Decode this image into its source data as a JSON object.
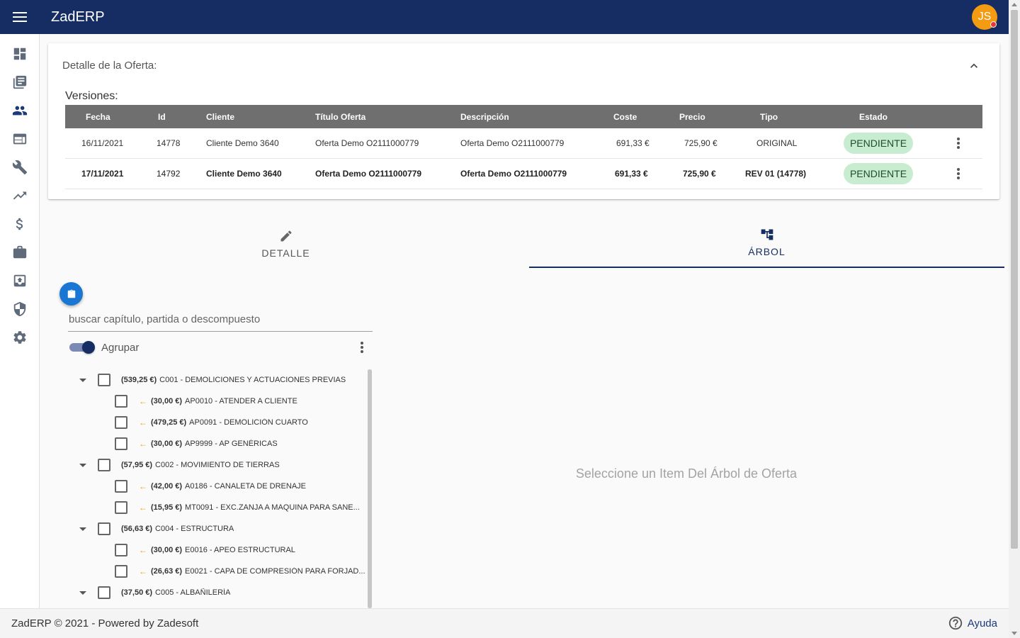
{
  "app": {
    "title": "ZadERP",
    "avatar_initials": "JS"
  },
  "sidebar": {
    "items": [
      {
        "name": "dashboard",
        "icon": "dashboard-icon"
      },
      {
        "name": "library",
        "icon": "library-books-icon"
      },
      {
        "name": "people",
        "icon": "people-icon",
        "active": true
      },
      {
        "name": "window",
        "icon": "web-window-icon"
      },
      {
        "name": "tools",
        "icon": "wrench-icon"
      },
      {
        "name": "trending",
        "icon": "trending-up-icon"
      },
      {
        "name": "money",
        "icon": "dollar-icon"
      },
      {
        "name": "work",
        "icon": "briefcase-icon"
      },
      {
        "name": "archive",
        "icon": "archive-upload-icon"
      },
      {
        "name": "security",
        "icon": "shield-icon"
      },
      {
        "name": "settings",
        "icon": "gear-icon"
      }
    ]
  },
  "card": {
    "title": "Detalle de la Oferta:",
    "versions_label": "Versiones:",
    "columns": [
      "Fecha",
      "Id",
      "Cliente",
      "Título Oferta",
      "Descripción",
      "Coste",
      "Precio",
      "Tipo",
      "Estado"
    ],
    "rows": [
      {
        "fecha": "16/11/2021",
        "id": "14778",
        "cliente": "Cliente Demo 3640",
        "titulo": "Oferta Demo O2111000779",
        "descripcion": "Oferta Demo O2111000779",
        "coste": "691,33 €",
        "precio": "725,90 €",
        "tipo": "ORIGINAL",
        "estado": "PENDIENTE"
      },
      {
        "fecha": "17/11/2021",
        "id": "14792",
        "cliente": "Cliente Demo 3640",
        "titulo": "Oferta Demo O2111000779",
        "descripcion": "Oferta Demo O2111000779",
        "coste": "691,33 €",
        "precio": "725,90 €",
        "tipo": "REV 01 (14778)",
        "estado": "PENDIENTE"
      }
    ]
  },
  "tabs": [
    {
      "label": "DETALLE",
      "icon": "pencil-icon"
    },
    {
      "label": "ÁRBOL",
      "icon": "tree-icon",
      "active": true
    }
  ],
  "tree_panel": {
    "search_placeholder": "buscar capítulo, partida o descompuesto",
    "group_label": "Agrupar",
    "group_on": true,
    "nodes": [
      {
        "level": 0,
        "price": "(539,25 €)",
        "text": "C001 - DEMOLICIONES Y ACTUACIONES PREVIAS"
      },
      {
        "level": 1,
        "price": "(30,00 €)",
        "text": "AP0010 - ATENDER A CLIENTE"
      },
      {
        "level": 1,
        "price": "(479,25 €)",
        "text": "AP0091 - DEMOLICIÓN CUARTO"
      },
      {
        "level": 1,
        "price": "(30,00 €)",
        "text": "AP9999 - AP GENÉRICAS"
      },
      {
        "level": 0,
        "price": "(57,95 €)",
        "text": "C002 - MOVIMIENTO DE TIERRAS"
      },
      {
        "level": 1,
        "price": "(42,00 €)",
        "text": "A0186 - CANALETA DE DRENAJE"
      },
      {
        "level": 1,
        "price": "(15,95 €)",
        "text": "MT0091 - EXC.ZANJA A MAQUINA PARA SANE..."
      },
      {
        "level": 0,
        "price": "(56,63 €)",
        "text": "C004 - ESTRUCTURA"
      },
      {
        "level": 1,
        "price": "(30,00 €)",
        "text": "E0016 - APEO ESTRUCTURAL"
      },
      {
        "level": 1,
        "price": "(26,63 €)",
        "text": "E0021 - CAPA DE COMPRESIÓN PARA FORJAD..."
      },
      {
        "level": 0,
        "price": "(37,50 €)",
        "text": "C005 - ALBAÑILERÍA"
      }
    ]
  },
  "empty_message": "Seleccione un Item Del Árbol de Oferta",
  "footer": {
    "text": "ZadERP © 2021 - Powered by Zadesoft",
    "help_label": "Ayuda"
  },
  "colors": {
    "primary": "#152d63",
    "accent": "#f39c12",
    "status_bg": "#c8ecd0",
    "fab": "#1976d2"
  }
}
